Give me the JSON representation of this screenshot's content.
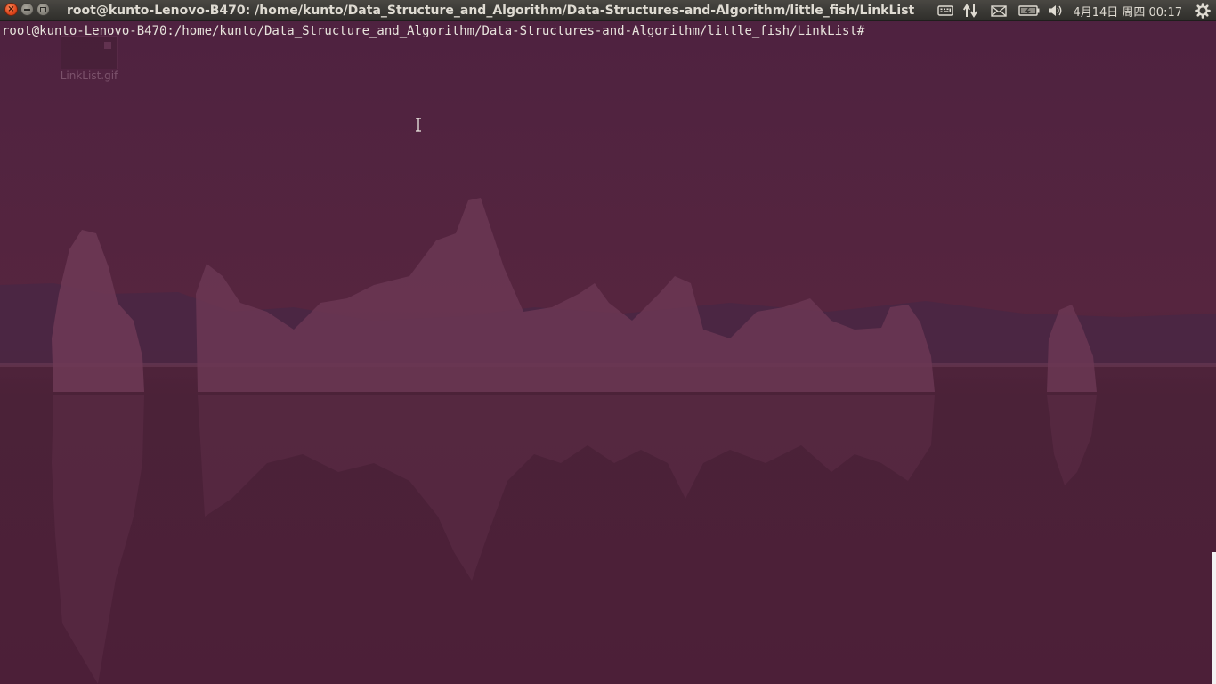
{
  "desktop": {
    "icons": [
      {
        "label": "LinkList.gif"
      }
    ]
  },
  "panel": {
    "window_buttons": {
      "close_glyph": "×"
    },
    "window_title": "root@kunto-Lenovo-B470: /home/kunto/Data_Structure_and_Algorithm/Data-Structures-and-Algorithm/little_fish/LinkList",
    "indicators": [
      {
        "icon": "keyboard-icon"
      },
      {
        "icon": "network-transfer-icon"
      },
      {
        "icon": "mail-icon"
      },
      {
        "icon": "battery-icon"
      },
      {
        "icon": "volume-icon"
      },
      {
        "icon": "gear-icon"
      }
    ],
    "clock": "4月14日 周四 00:17"
  },
  "terminal": {
    "prompt": "root@kunto-Lenovo-B470:/home/kunto/Data_Structure_and_Algorithm/Data-Structures-and-Algorithm/little_fish/LinkList#"
  },
  "colors": {
    "background": "#4a2238",
    "panel": "#3a3935",
    "text": "#e7e3dc",
    "close_button": "#e0461c"
  }
}
